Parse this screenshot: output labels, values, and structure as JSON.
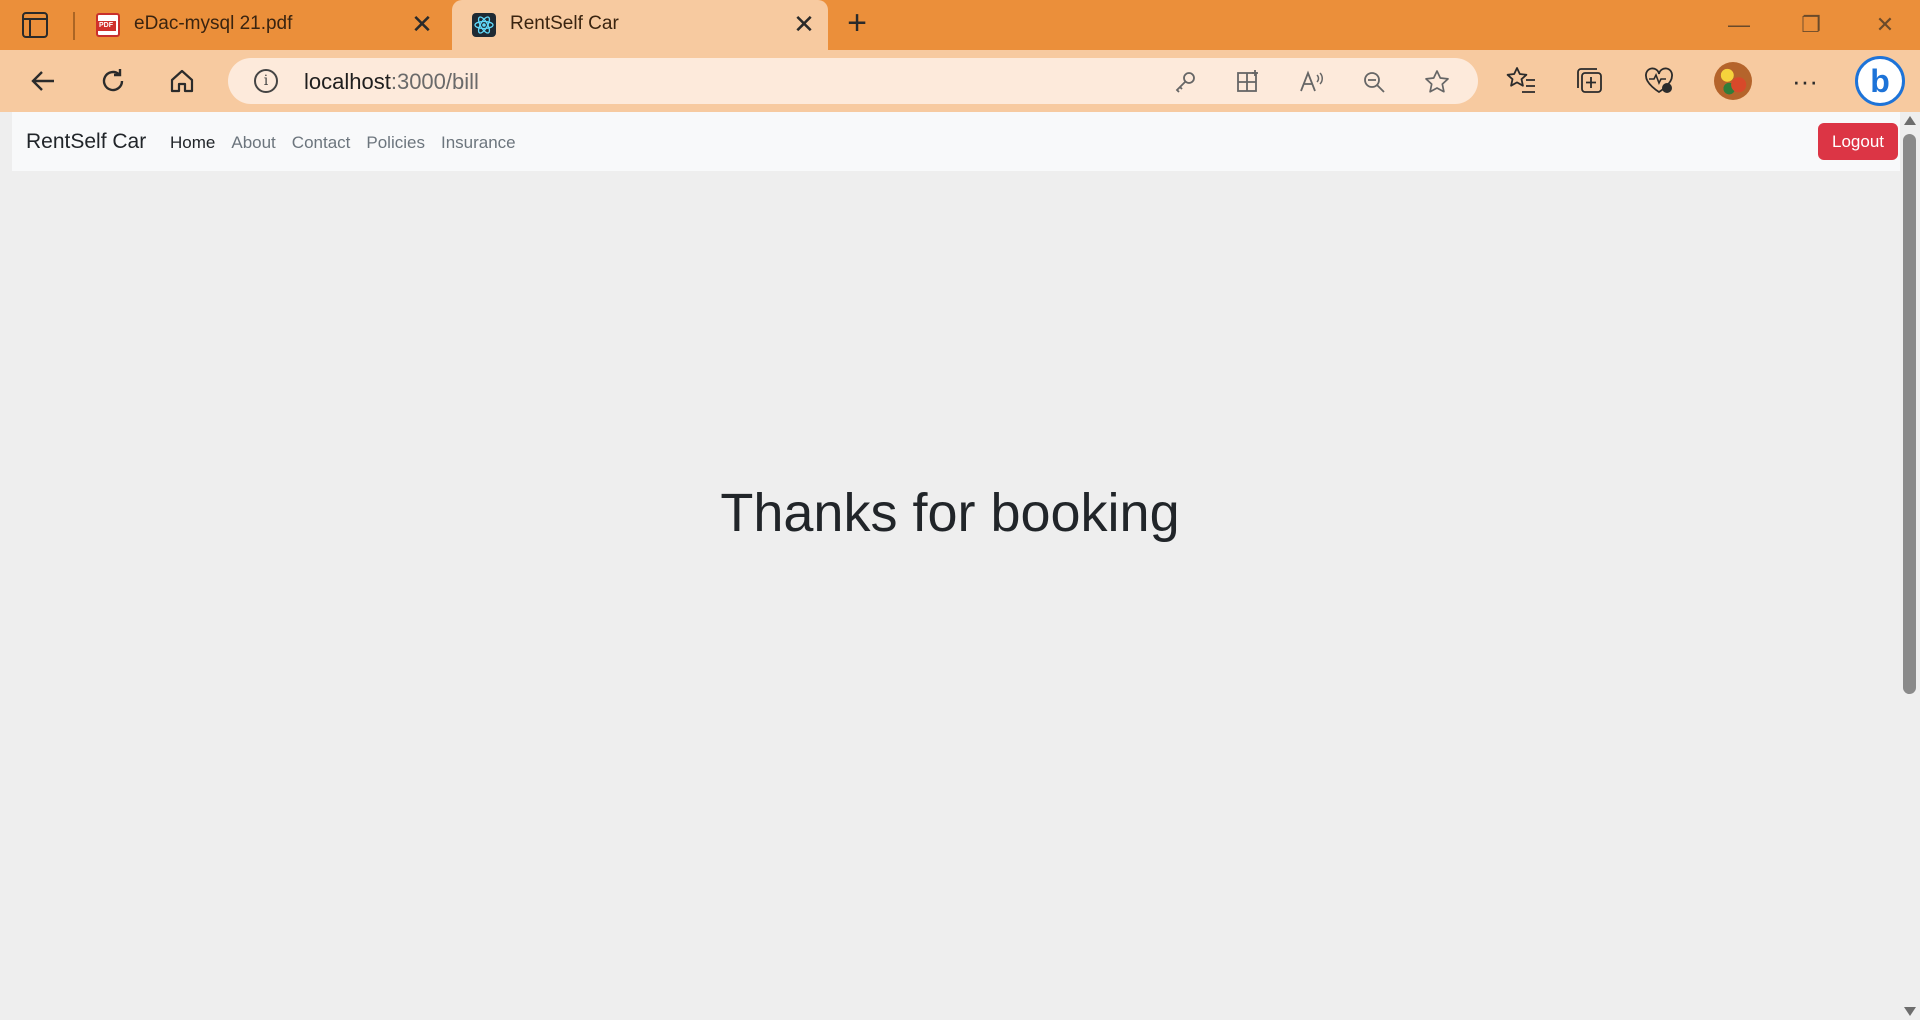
{
  "browser": {
    "tabs": [
      {
        "title": "eDac-mysql 21.pdf",
        "favicon": "pdf-icon",
        "active": false
      },
      {
        "title": "RentSelf Car",
        "favicon": "react-icon",
        "active": true
      }
    ],
    "new_tab_glyph": "+",
    "close_glyph": "✕",
    "address": {
      "host": "localhost",
      "path": ":3000/bill"
    },
    "window_controls": {
      "minimize": "—",
      "restore": "❐",
      "close": "✕"
    },
    "colors": {
      "tabstrip": "#eb8f3a",
      "toolbar": "#f7caa0",
      "omnibox": "#fdeadb"
    }
  },
  "navbar": {
    "brand": "RentSelf Car",
    "links": [
      "Home",
      "About",
      "Contact",
      "Policies",
      "Insurance"
    ],
    "active_link": "Home",
    "logout_label": "Logout",
    "logout_color": "#dc3545"
  },
  "main": {
    "message": "Thanks for booking"
  }
}
